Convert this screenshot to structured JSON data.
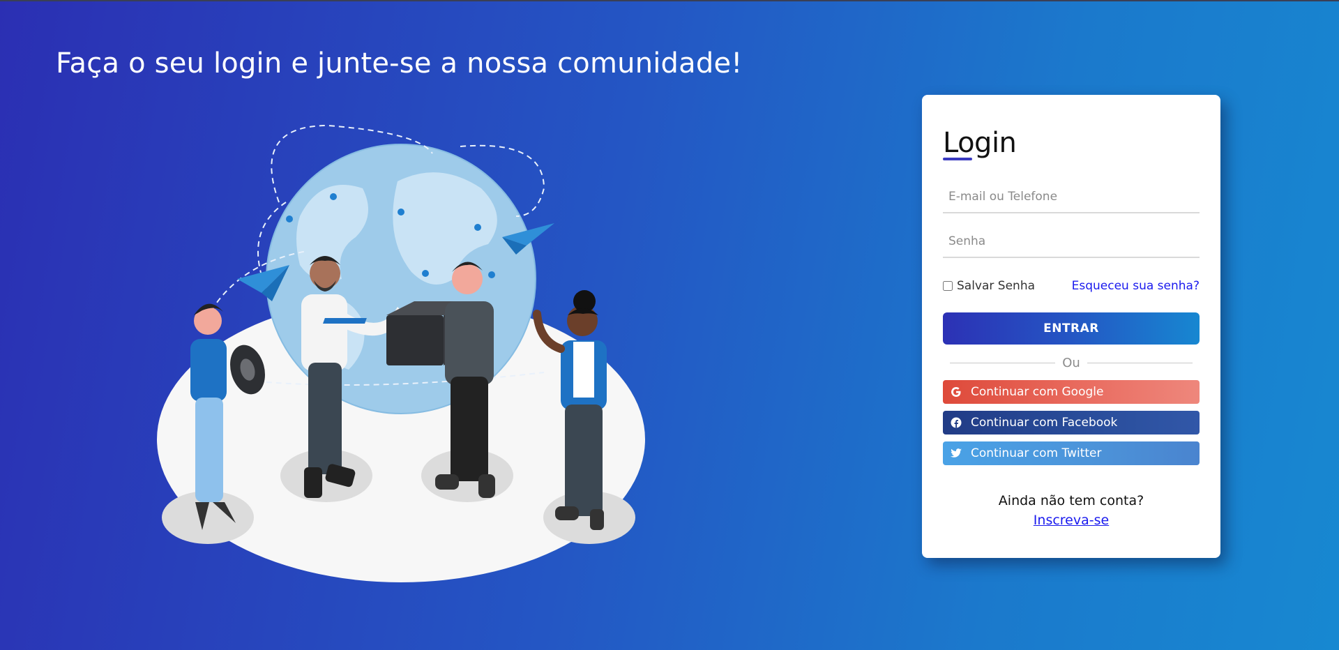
{
  "headline": "Faça o seu login e junte-se a nossa comunidade!",
  "illustration": {
    "icon": "community-globe-illustration"
  },
  "login": {
    "title": "Login",
    "email_placeholder": "E-mail ou Telefone",
    "password_placeholder": "Senha",
    "remember_label": "Salvar Senha",
    "forgot_label": "Esqueceu sua senha?",
    "submit_label": "ENTRAR",
    "divider_label": "Ou",
    "social": {
      "google_label": "Continuar com Google",
      "facebook_label": "Continuar com Facebook",
      "twitter_label": "Continuar com Twitter"
    },
    "signup_prompt": "Ainda não tem conta?",
    "signup_link": "Inscreva-se"
  },
  "colors": {
    "accent": "#2456c4",
    "google": "#de4a3a",
    "facebook": "#213c86",
    "twitter": "#4aa2e6",
    "link": "#1a1aee"
  }
}
